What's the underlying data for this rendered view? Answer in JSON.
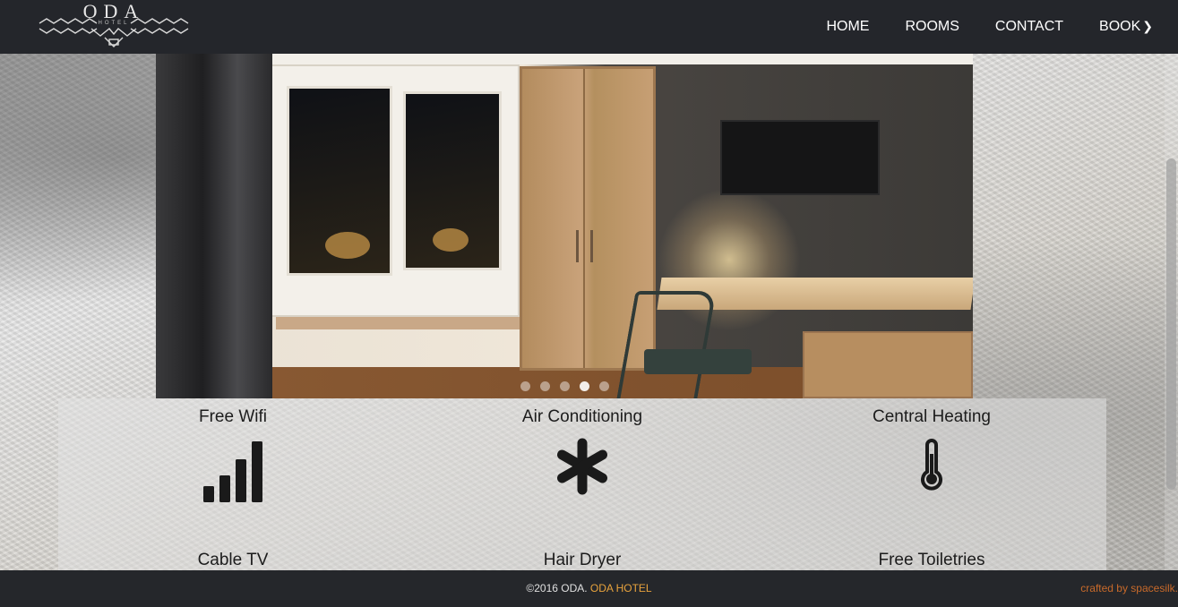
{
  "header": {
    "logo_text": "ODA",
    "logo_sub": "HOTEL",
    "nav": [
      {
        "label": "HOME"
      },
      {
        "label": "ROOMS"
      },
      {
        "label": "CONTACT"
      },
      {
        "label": "BOOK"
      }
    ]
  },
  "slider": {
    "dot_count": 5,
    "active_index": 3
  },
  "amenities": [
    {
      "label": "Free Wifi",
      "icon": "signal-bars-icon"
    },
    {
      "label": "Air Conditioning",
      "icon": "snowflake-icon"
    },
    {
      "label": "Central Heating",
      "icon": "thermometer-icon"
    },
    {
      "label": "Cable TV",
      "icon": "tv-icon"
    },
    {
      "label": "Hair Dryer",
      "icon": "hair-dryer-icon"
    },
    {
      "label": "Free Toiletries",
      "icon": "toiletries-icon"
    }
  ],
  "footer": {
    "copy_prefix": "©2016 ODA. ",
    "brand": "ODA HOTEL",
    "credit": "crafted by spacesilk."
  },
  "colors": {
    "header_bg": "#24262b",
    "footer_brand": "#e8a33d",
    "footer_credit": "#c86a2b"
  }
}
